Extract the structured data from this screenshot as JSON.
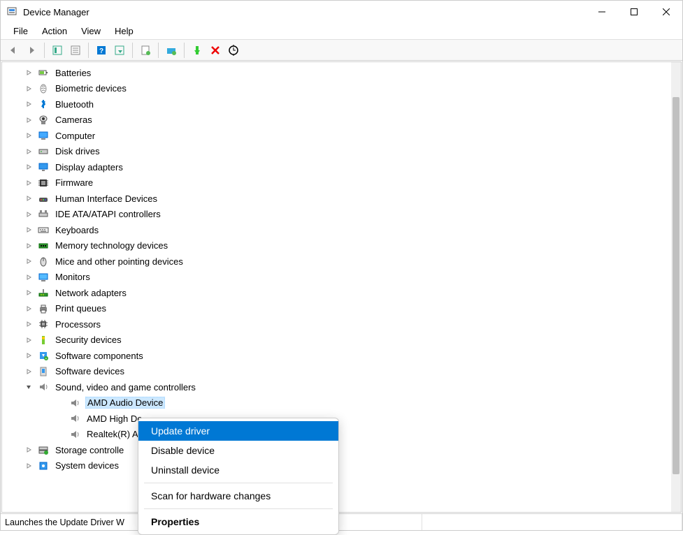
{
  "title": "Device Manager",
  "menubar": [
    "File",
    "Action",
    "View",
    "Help"
  ],
  "toolbar": [
    {
      "name": "back",
      "sep": false
    },
    {
      "name": "forward",
      "sep": true
    },
    {
      "name": "show-hide-tree",
      "sep": false
    },
    {
      "name": "properties-sheet",
      "sep": true
    },
    {
      "name": "help",
      "sep": false
    },
    {
      "name": "action-list",
      "sep": true
    },
    {
      "name": "update-driver",
      "sep": true
    },
    {
      "name": "uninstall",
      "sep": true
    },
    {
      "name": "enable",
      "sep": false
    },
    {
      "name": "disable",
      "sep": false
    },
    {
      "name": "scan-hardware",
      "sep": false
    }
  ],
  "tree": [
    {
      "label": "Batteries",
      "icon": "battery",
      "exp": ">"
    },
    {
      "label": "Biometric devices",
      "icon": "biometric",
      "exp": ">"
    },
    {
      "label": "Bluetooth",
      "icon": "bluetooth",
      "exp": ">"
    },
    {
      "label": "Cameras",
      "icon": "camera",
      "exp": ">"
    },
    {
      "label": "Computer",
      "icon": "computer",
      "exp": ">"
    },
    {
      "label": "Disk drives",
      "icon": "disk",
      "exp": ">"
    },
    {
      "label": "Display adapters",
      "icon": "display",
      "exp": ">"
    },
    {
      "label": "Firmware",
      "icon": "firmware",
      "exp": ">"
    },
    {
      "label": "Human Interface Devices",
      "icon": "hid",
      "exp": ">"
    },
    {
      "label": "IDE ATA/ATAPI controllers",
      "icon": "ide",
      "exp": ">"
    },
    {
      "label": "Keyboards",
      "icon": "keyboard",
      "exp": ">"
    },
    {
      "label": "Memory technology devices",
      "icon": "memory",
      "exp": ">"
    },
    {
      "label": "Mice and other pointing devices",
      "icon": "mouse",
      "exp": ">"
    },
    {
      "label": "Monitors",
      "icon": "monitor",
      "exp": ">"
    },
    {
      "label": "Network adapters",
      "icon": "network",
      "exp": ">"
    },
    {
      "label": "Print queues",
      "icon": "printer",
      "exp": ">"
    },
    {
      "label": "Processors",
      "icon": "cpu",
      "exp": ">"
    },
    {
      "label": "Security devices",
      "icon": "security",
      "exp": ">"
    },
    {
      "label": "Software components",
      "icon": "swcomp",
      "exp": ">"
    },
    {
      "label": "Software devices",
      "icon": "swdev",
      "exp": ">"
    },
    {
      "label": "Sound, video and game controllers",
      "icon": "sound",
      "exp": "v",
      "children": [
        {
          "label": "AMD Audio Device",
          "icon": "sound",
          "selected": true
        },
        {
          "label": "AMD High De",
          "icon": "sound"
        },
        {
          "label": "Realtek(R) Au",
          "icon": "sound"
        }
      ]
    },
    {
      "label": "Storage controlle",
      "icon": "storage",
      "exp": ">"
    },
    {
      "label": "System devices",
      "icon": "system",
      "exp": ">"
    }
  ],
  "context_menu": [
    {
      "label": "Update driver",
      "highlighted": true
    },
    {
      "label": "Disable device"
    },
    {
      "label": "Uninstall device"
    },
    {
      "sep": true
    },
    {
      "label": "Scan for hardware changes"
    },
    {
      "sep": true
    },
    {
      "label": "Properties",
      "bold": true
    }
  ],
  "statusbar": "Launches the Update Driver W"
}
